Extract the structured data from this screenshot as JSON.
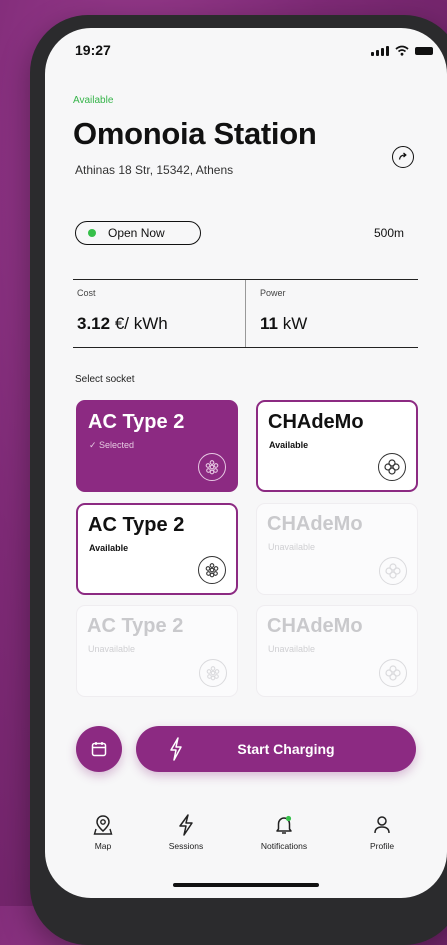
{
  "status_bar": {
    "time": "19:27"
  },
  "station": {
    "availability": "Available",
    "name": "Omonoia Station",
    "address": "Athinas 18 Str, 15342, Athens",
    "open_status": "Open Now",
    "distance": "500m"
  },
  "metrics": {
    "cost": {
      "label": "Cost",
      "value": "3.12",
      "unit": "€/ kWh"
    },
    "power": {
      "label": "Power",
      "value": "11",
      "unit": "kW"
    }
  },
  "sockets": {
    "section_label": "Select socket",
    "items": [
      {
        "name": "AC Type 2",
        "status": "✓ Selected",
        "state": "selected"
      },
      {
        "name": "CHAdeMo",
        "status": "Available",
        "state": "available"
      },
      {
        "name": "AC Type 2",
        "status": "Available",
        "state": "available"
      },
      {
        "name": "CHAdeMo",
        "status": "Unavailable",
        "state": "unavailable"
      },
      {
        "name": "AC Type 2",
        "status": "Unavailable",
        "state": "unavailable"
      },
      {
        "name": "CHAdeMo",
        "status": "Unavailable",
        "state": "unavailable"
      }
    ]
  },
  "actions": {
    "start_label": "Start Charging"
  },
  "tabs": [
    {
      "label": "Map",
      "icon": "map-pin-icon"
    },
    {
      "label": "Sessions",
      "icon": "lightning-icon"
    },
    {
      "label": "Notifications",
      "icon": "bell-icon"
    },
    {
      "label": "Profile",
      "icon": "user-icon"
    }
  ],
  "colors": {
    "accent": "#8c2a82",
    "available_green": "#36b44a",
    "background": "#7e2a76"
  }
}
